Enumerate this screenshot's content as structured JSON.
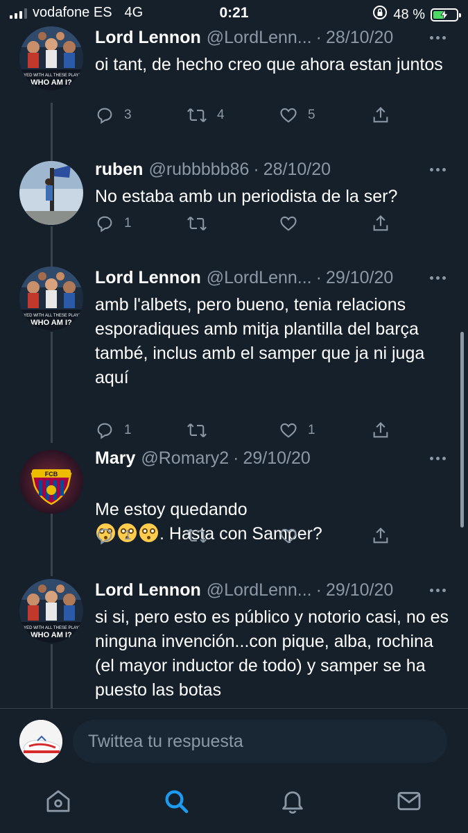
{
  "status_bar": {
    "carrier": "vodafone ES",
    "network": "4G",
    "time": "0:21",
    "battery_percent": "48 %",
    "battery_level": 0.48
  },
  "tweets": [
    {
      "name": "Lord Lennon",
      "handle": "@LordLenn...",
      "date": "28/10/20",
      "text": "oi tant, de hecho creo que ahora estan juntos",
      "replies": "3",
      "retweets": "4",
      "likes": "5"
    },
    {
      "name": "ruben",
      "handle": "@rubbbbb86",
      "date": "28/10/20",
      "text": "No estaba amb un periodista de la ser?",
      "replies": "1",
      "retweets": "",
      "likes": ""
    },
    {
      "name": "Lord Lennon",
      "handle": "@LordLenn...",
      "date": "29/10/20",
      "text": "amb l'albets, pero bueno, tenia relacions esporadiques amb mitja plantilla del barça també, inclus amb el samper que ja ni juga aquí",
      "replies": "1",
      "retweets": "",
      "likes": "1"
    },
    {
      "name": "Mary",
      "handle": "@Romary2",
      "date": "29/10/20",
      "text_before": "Me estoy quedando",
      "emoji": "flushed-face",
      "text_after": ". Hasta con Samper?",
      "replies": "1",
      "retweets": "",
      "likes": ""
    },
    {
      "name": "Lord Lennon",
      "handle": "@LordLenn...",
      "date": "29/10/20",
      "text": "si si, pero esto es público y notorio casi, no es ninguna invención...con pique, alba, rochina (el mayor inductor de todo) y samper se ha puesto las botas",
      "replies": "",
      "retweets": "",
      "likes": ""
    }
  ],
  "avatar_texts": {
    "poster_caption_1": "AYED WITH ALL THESE PLAYE",
    "poster_caption_2": "WHO AM I?",
    "crest": "FCB"
  },
  "reply": {
    "placeholder": "Twittea tu respuesta"
  },
  "tab_bar": {
    "items": [
      "home-icon",
      "search-icon",
      "notifications-icon",
      "messages-icon"
    ],
    "active": "search-icon"
  },
  "colors": {
    "background": "#15202b",
    "secondary_text": "#8b98a5",
    "accent": "#1d9bf0",
    "divider": "#38444d"
  }
}
